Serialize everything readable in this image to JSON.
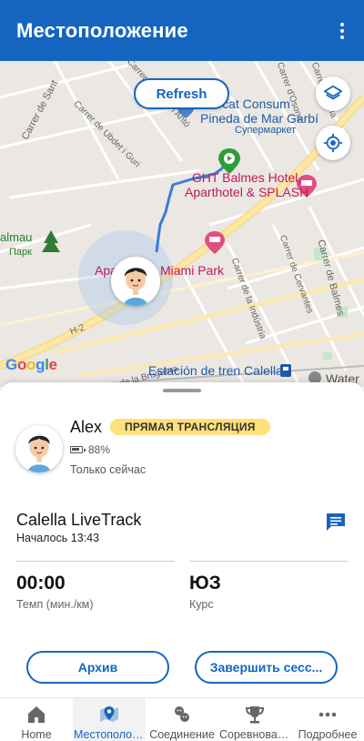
{
  "appbar": {
    "title": "Местоположение",
    "more_icon": "more-vert-icon"
  },
  "map": {
    "refresh_label": "Refresh",
    "google_label": "Google",
    "pois": {
      "mercat": "Mercat Consum Pineda de Mar Garbí",
      "mercat_line1": "mercat Consum",
      "mercat_line2": "Pineda de Mar Garbí",
      "supermarket": "Супермаркет",
      "hotel_line1": "GHT Balmes Hotel,",
      "hotel_line2": "Aparthotel & SPLASH",
      "park_left": "almau",
      "park_left_sub": "Парк",
      "apart_left": "Apa",
      "miami": "Miami Park",
      "station": "Estación de tren Calella",
      "water": "Water"
    },
    "streets": {
      "s1": "Carrer de Sant",
      "s2": "Carrer de Ubdet i Guri",
      "s3": "Carrer Bellmunt i Antó",
      "s4": "Carrer de Balmes",
      "s5": "Carrer de Cervantes",
      "s6": "Carrer de la Indústria",
      "s7": "Carrer de la Bruguera",
      "s8": "H-2",
      "s9": "Carrer d'Anoia",
      "s10": "Carrer d'Osona",
      "s11": "Carrer de Balmes",
      "s12": "Carrer de Cervantes"
    },
    "layers_icon": "layers-icon",
    "locate_icon": "my-location-icon"
  },
  "sheet": {
    "user": {
      "name": "Alex",
      "status_badge": "ПРЯМАЯ ТРАНСЛЯЦИЯ",
      "battery": "88%",
      "last_seen": "Только сейчас"
    },
    "event": {
      "name": "Calella LiveTrack",
      "started": "Началось 13:43"
    },
    "stats": [
      {
        "value": "00:00",
        "label": "Темп (мин./км)"
      },
      {
        "value": "ЮЗ",
        "label": "Курс"
      }
    ],
    "buttons": {
      "archive": "Архив",
      "end_session": "Завершить сесс..."
    }
  },
  "bottom_nav": [
    {
      "label": "Home",
      "icon": "home-icon"
    },
    {
      "label": "Местоположение",
      "icon": "map-pin-icon",
      "active": true
    },
    {
      "label": "Соединение",
      "icon": "connections-icon"
    },
    {
      "label": "Соревнования",
      "icon": "trophy-icon"
    },
    {
      "label": "Подробнее",
      "icon": "more-horiz-icon"
    }
  ],
  "colors": {
    "primary": "#1565c0",
    "badge": "#ffe07a",
    "poi_pink": "#c2185b",
    "route": "#3b7dd8"
  }
}
